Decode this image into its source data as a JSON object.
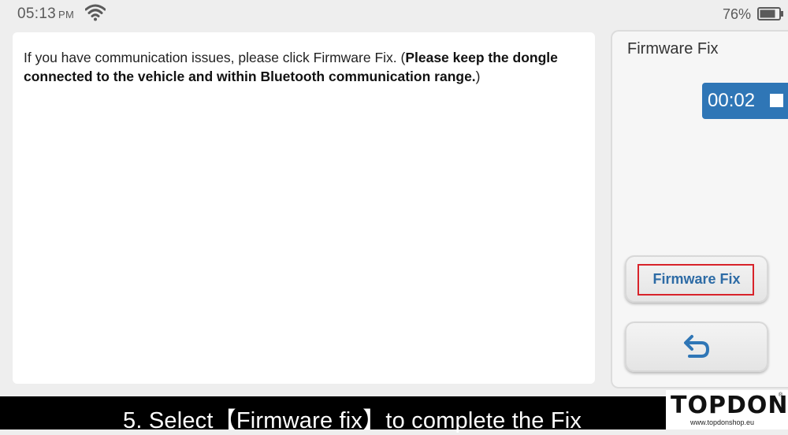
{
  "status_bar": {
    "time": "05:13",
    "ampm": "PM",
    "battery": "76%",
    "icons": [
      "wifi-icon",
      "battery-icon"
    ]
  },
  "main": {
    "message_plain": "If you have communication issues, please click Firmware Fix. (",
    "message_bold": "Please keep the dongle connected to the vehicle and within Bluetooth communication range.",
    "message_end": ")"
  },
  "side": {
    "title": "Firmware Fix",
    "timer": "00:02",
    "firmware_fix_button": "Firmware Fix",
    "back_icon": "back-icon"
  },
  "caption": {
    "text": "5. Select【Firmware fix】to complete the Fix"
  },
  "logo": {
    "brand": "TOPDON",
    "registered": "®",
    "url": "www.topdonshop.eu"
  },
  "colors": {
    "accent": "#2f76b6",
    "highlight": "#d8232a",
    "button_text": "#2d6ba5"
  }
}
